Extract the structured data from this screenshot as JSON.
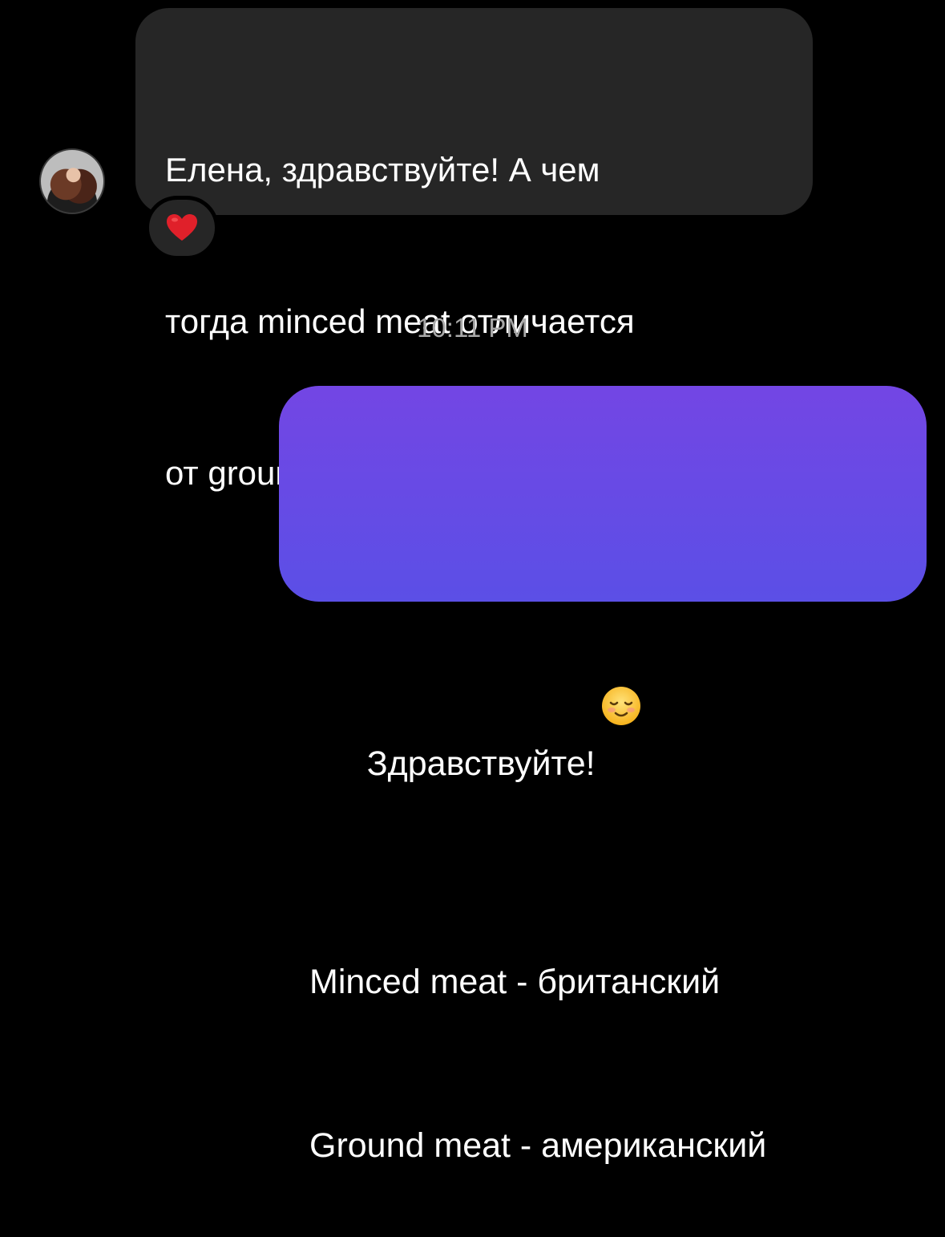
{
  "incoming": {
    "text_line1": "Елена, здравствуйте! А чем",
    "text_line2": "тогда minced meat отличается",
    "text_line3": "от ground meat?",
    "reaction": "heart-emoji"
  },
  "timestamp": "10:11 PM",
  "outgoing": {
    "text_line1": "Здравствуйте!",
    "emoji": "smiling-face-emoji",
    "text_line2": "Minced meat - британский",
    "text_line3": "Ground meat - американский"
  },
  "colors": {
    "background": "#000000",
    "incoming_bubble": "#262626",
    "outgoing_bubble_top": "#7346e4",
    "outgoing_bubble_bottom": "#5b4fe6",
    "timestamp_text": "#a8a8a8",
    "heart": "#e0202a"
  }
}
